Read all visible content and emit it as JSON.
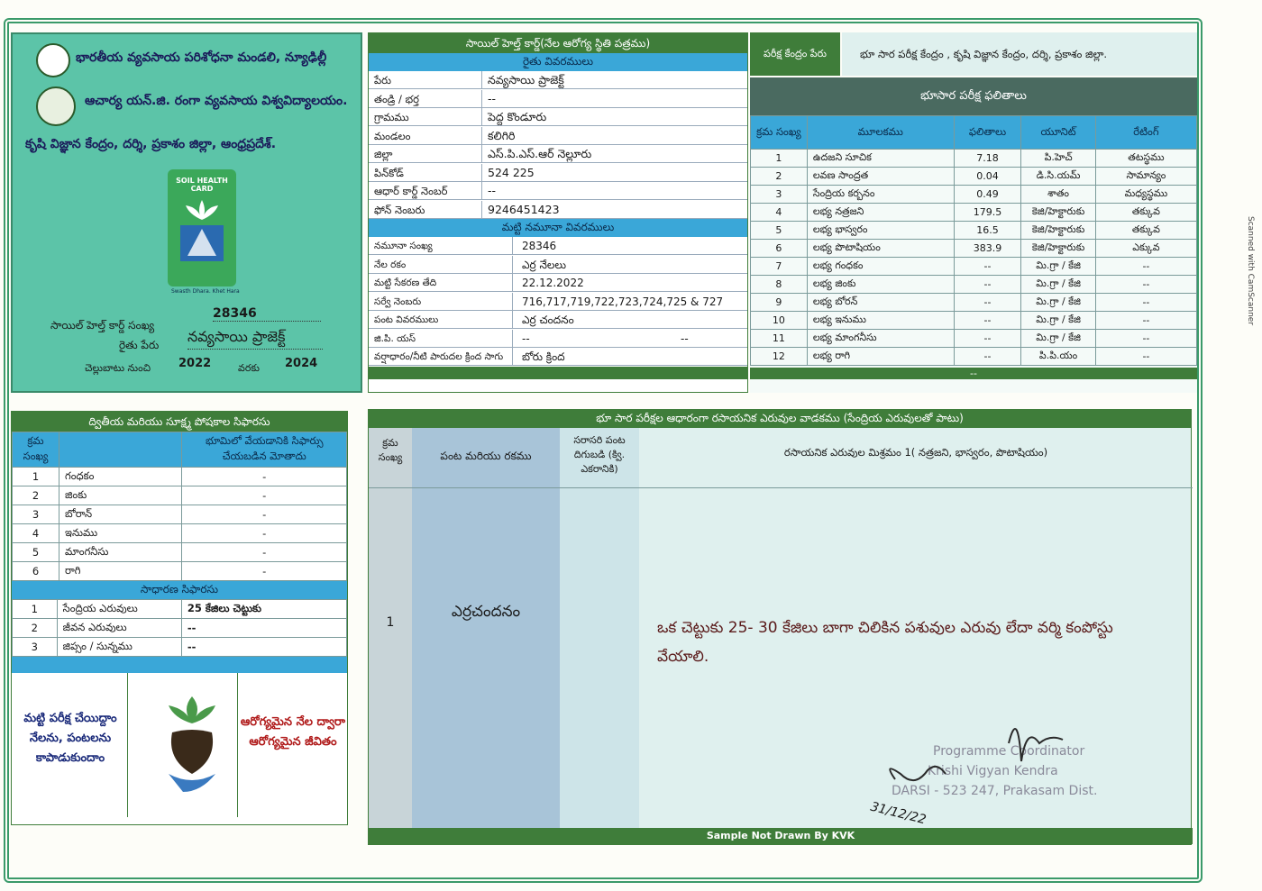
{
  "header_left": {
    "line1": "భారతీయ వ్యవసాయ పరిశోధనా మండలి, న్యూఢిల్లీ",
    "line2": "ఆచార్య యన్.జి. రంగా వ్యవసాయ విశ్వవిద్యాలయం.",
    "line3": "కృషి విజ్ఞాన కేంద్రం, దర్శి, ప్రకాశం జిల్లా, ఆంధ్రప్రదేశ్.",
    "logo_text1": "SOIL HEALTH",
    "logo_text2": "CARD",
    "logo_tag": "Swasth Dhara. Khet Hara",
    "card_no_label": "సాయిల్ హెల్త్ కార్డ్ సంఖ్య",
    "card_no": "28346",
    "farmer_label": "రైతు పేరు",
    "farmer": "నవ్యసాయి ప్రాజెక్ట్",
    "validity_label_from": "చెల్లుబాటు నుంచి",
    "validity_from": "2022",
    "validity_label_to": "వరకు",
    "validity_to": "2024"
  },
  "card_title": "సాయిల్ హెల్త్ కార్డ్(నేల ఆరోగ్య స్థితి పత్రము)",
  "farmer_details_title": "రైతు వివరములు",
  "farmer_details": [
    {
      "label": "పేరు",
      "value": "నవ్యసాయి ప్రాజెక్ట్"
    },
    {
      "label": "తండ్రి / భర్త",
      "value": "--"
    },
    {
      "label": "గ్రామము",
      "value": "పెద్ద కొండూరు"
    },
    {
      "label": "మండలం",
      "value": "కలిగిరి"
    },
    {
      "label": "జిల్లా",
      "value": "ఎస్.పి.ఎస్.ఆర్ నెల్లూరు"
    },
    {
      "label": "పిన్‌కోడ్",
      "value": "524 225"
    },
    {
      "label": "ఆధార్ కార్డ్ నెంబర్",
      "value": "--"
    },
    {
      "label": "ఫోన్ నెంబరు",
      "value": "9246451423"
    }
  ],
  "sample_details_title": "మట్టి నమూనా వివరములు",
  "sample_details": [
    {
      "label": "నమూనా సంఖ్య",
      "value": "28346"
    },
    {
      "label": "నేల రకం",
      "value": "ఎర్ర నేలలు"
    },
    {
      "label": "మట్టి సేకరణ తేది",
      "value": "22.12.2022"
    },
    {
      "label": "సర్వే నెంబరు",
      "value": "716,717,719,722,723,724,725 & 727"
    },
    {
      "label": "పంట వివరములు",
      "value": "ఎర్ర చందనం"
    },
    {
      "label": "జి.పి. యస్",
      "value": "--",
      "value2": "--"
    },
    {
      "label": "వర్షాధారం/నీటి పారుదల క్రింద సాగు",
      "value": "బోరు క్రింద"
    }
  ],
  "lab": {
    "label": "పరీక్ష కేంద్రం పేరు",
    "value": "భూ సార పరీక్ష కేంద్రం , కృషి విజ్ఞాన కేంద్రం, దర్శి, ప్రకాశం జిల్లా."
  },
  "results": {
    "title": "భూసార పరీక్ష ఫలితాలు",
    "headers": [
      "క్రమ సంఖ్య",
      "మూలకము",
      "ఫలితాలు",
      "యూనిట్",
      "రేటింగ్"
    ],
    "rows": [
      [
        "1",
        "ఉదజని సూచిక",
        "7.18",
        "పి.హెచ్",
        "తటస్థము"
      ],
      [
        "2",
        "లవణ సాంద్రత",
        "0.04",
        "డి.సి.యమ్",
        "సామాన్యం"
      ],
      [
        "3",
        "సేంద్రియ కర్బనం",
        "0.49",
        "శాతం",
        "మధ్యస్థము"
      ],
      [
        "4",
        "లభ్య నత్రజని",
        "179.5",
        "కెజి/హెక్టారుకు",
        "తక్కువ"
      ],
      [
        "5",
        "లభ్య భాస్వరం",
        "16.5",
        "కెజి/హెక్టారుకు",
        "తక్కువ"
      ],
      [
        "6",
        "లభ్య పొటాషియం",
        "383.9",
        "కెజి/హెక్టారుకు",
        "ఎక్కువ"
      ],
      [
        "7",
        "లభ్య గంధకం",
        "--",
        "మి.గ్రా / కేజి",
        "--"
      ],
      [
        "8",
        "లభ్య జింకు",
        "--",
        "మి.గ్రా / కేజి",
        "--"
      ],
      [
        "9",
        "లభ్య బోరన్",
        "--",
        "మి.గ్రా / కేజి",
        "--"
      ],
      [
        "10",
        "లభ్య ఇనుము",
        "--",
        "మి.గ్రా / కేజి",
        "--"
      ],
      [
        "11",
        "లభ్య మాంగనీసు",
        "--",
        "మి.గ్రా / కేజి",
        "--"
      ],
      [
        "12",
        "లభ్య రాగి",
        "--",
        "పి.పి.యం",
        "--"
      ]
    ],
    "footer": "--"
  },
  "micro": {
    "title": "ద్వితీయ మరియు సూక్ష్మ పోషకాల సిఫారసు",
    "headers": [
      "క్రమ సంఖ్య",
      "",
      "భూమిలో వేయడానికి సిఫార్సు చేయబడిన మోతాదు"
    ],
    "rows": [
      [
        "1",
        "గంధకం",
        "-"
      ],
      [
        "2",
        "జింకు",
        "-"
      ],
      [
        "3",
        "బోరాన్",
        "-"
      ],
      [
        "4",
        "ఇనుము",
        "-"
      ],
      [
        "5",
        "మాంగనీసు",
        "-"
      ],
      [
        "6",
        "రాగి",
        "-"
      ]
    ],
    "general_title": "సాధారణ సిఫారసు",
    "general_rows": [
      [
        "1",
        "సేంద్రియ ఎరువులు",
        "25 కేజిలు చెట్టుకు"
      ],
      [
        "2",
        "జీవన ఎరువులు",
        "--"
      ],
      [
        "3",
        "జిప్సం / సున్నము",
        "--"
      ]
    ]
  },
  "slogans": {
    "left": "మట్టి పరీక్ష చేయిద్దాం నేలను, పంటలను కాపాడుకుందాం",
    "right": "ఆరోగ్యమైన నేల ద్వారా ఆరోగ్యమైన జీవితం"
  },
  "fertilizer": {
    "title": "భూ సార పరీక్షల ఆధారంగా రసాయనిక ఎరువుల వాడకము (సేంద్రియ ఎరువులతో పాటు)",
    "h_sno": "క్రమ సంఖ్య",
    "h_crop": "పంట మరియు రకము",
    "h_yield": "సరాసరి పంట దిగుబడి (క్వి. ఎకరానికి)",
    "h_mix": "రసాయనిక ఎరువుల మిశ్రమం 1( నత్రజని, భాస్వరం, పొటాషియం)",
    "sno": "1",
    "crop": "ఎర్రచందనం",
    "recommendation": "ఒక చెట్టుకు 25- 30 కేజిలు బాగా చిలికిన పశువుల ఎరువు లేదా వర్మి కంపోస్టు వేయాలి.",
    "stamp_line1": "Programme Coordinator",
    "stamp_line2": "Krishi Vigyan Kendra",
    "stamp_line3": "DARSI - 523 247, Prakasam Dist.",
    "sig_date": "31/12/22",
    "footer": "Sample Not Drawn By KVK"
  },
  "scanner": "Scanned with CamScanner",
  "colors": {
    "teal": "#5cc4a8",
    "green": "#3f7d3a",
    "blue": "#3aa7d8",
    "panel": "#dff0ee"
  }
}
